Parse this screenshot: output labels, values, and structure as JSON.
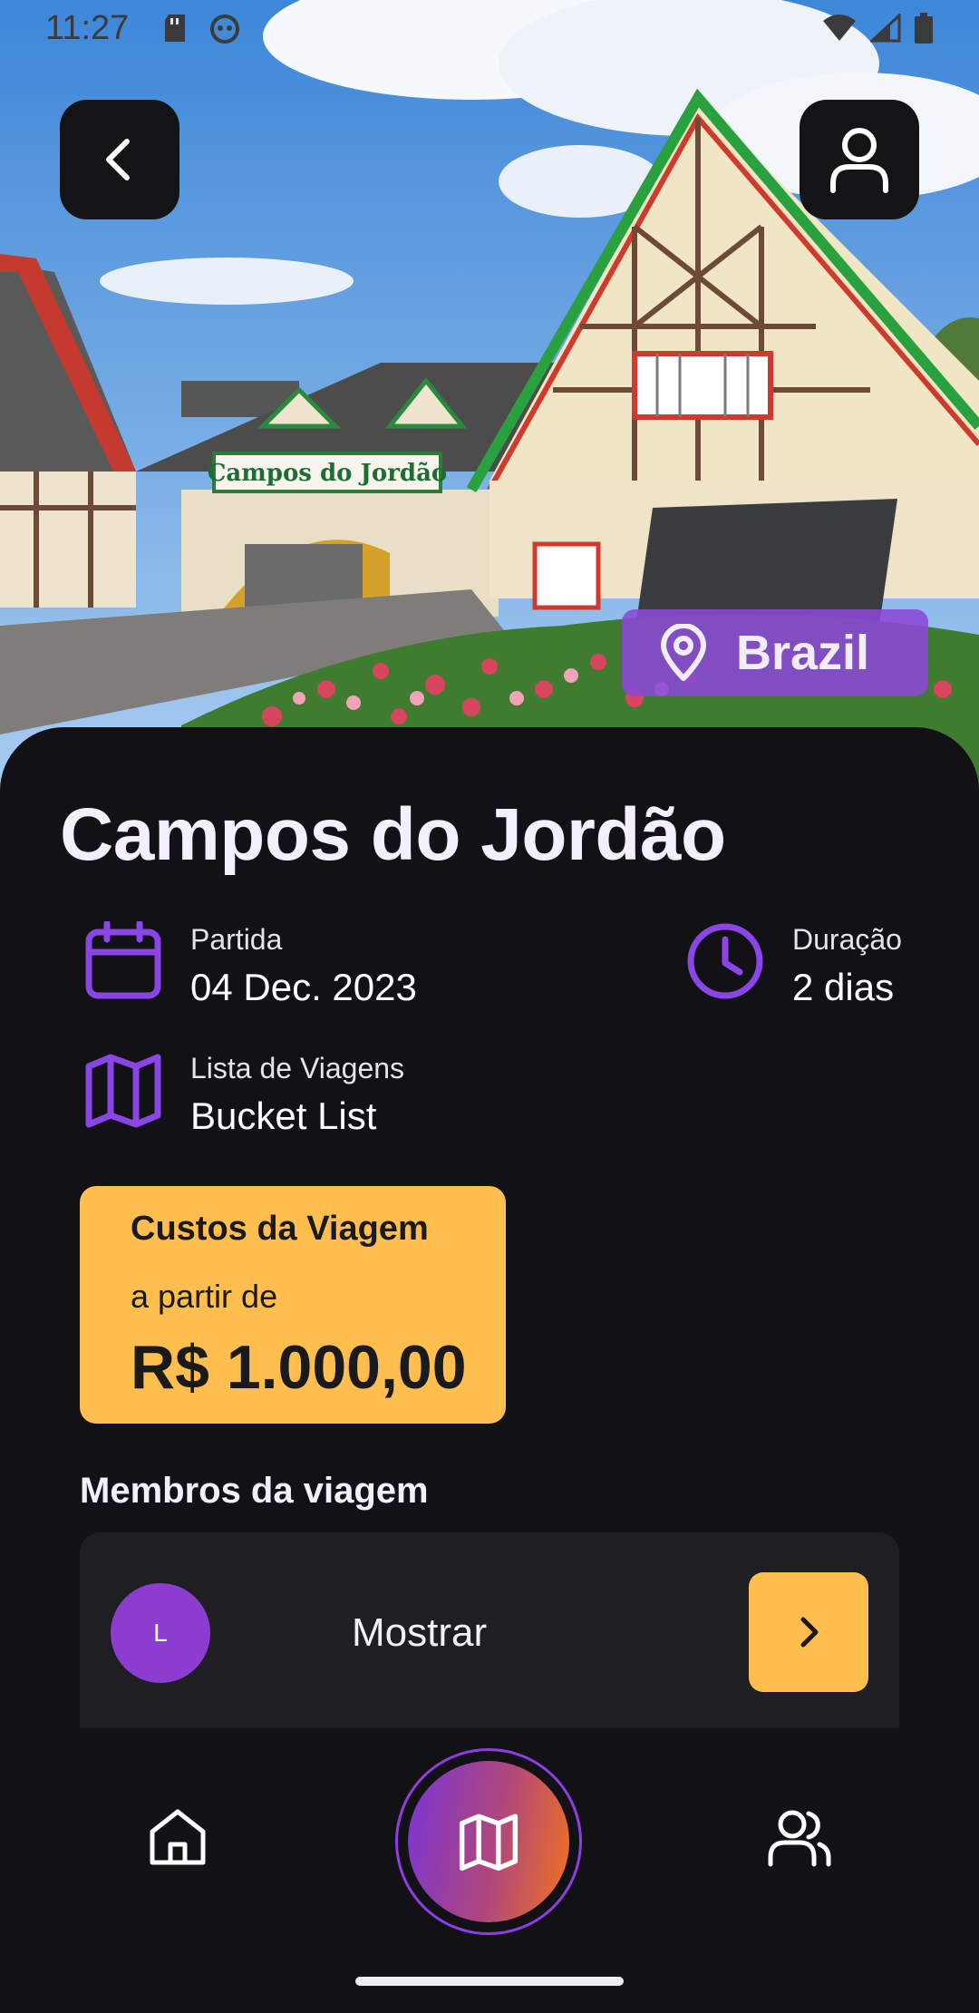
{
  "status_bar": {
    "time": "11:27"
  },
  "hero": {
    "sign_text": "Campos do Jordão"
  },
  "location": {
    "country": "Brazil"
  },
  "trip": {
    "title": "Campos do Jordão",
    "departure_label": "Partida",
    "departure_value": "04 Dec. 2023",
    "duration_label": "Duração",
    "duration_value": "2 dias",
    "list_label": "Lista de Viagens",
    "list_value": "Bucket List"
  },
  "cost": {
    "title": "Custos da Viagem",
    "from_label": "a partir de",
    "value": "R$ 1.000,00"
  },
  "members": {
    "heading": "Membros da viagem",
    "avatar_initial": "L",
    "show_label": "Mostrar"
  },
  "colors": {
    "background": "#121115",
    "accent_purple": "#8c3dd0",
    "accent_yellow": "#ffbe4e",
    "badge_purple": "#8a48d6"
  },
  "icons": {
    "back": "chevron-left-icon",
    "profile": "user-icon",
    "location": "map-pin-icon",
    "calendar": "calendar-icon",
    "clock": "clock-icon",
    "map": "map-icon",
    "next": "chevron-right-icon",
    "home": "home-icon",
    "members": "users-icon"
  }
}
